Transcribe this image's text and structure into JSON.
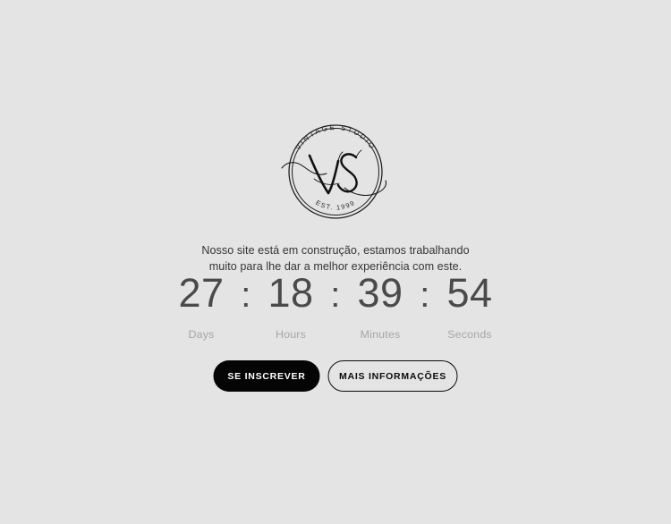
{
  "theme": {
    "background": "#e4e4e4",
    "text_dark": "#343434",
    "countdown_color": "#4a4a4a",
    "label_color": "#a6a6a6",
    "button_primary_bg": "#050505",
    "button_primary_text": "#ffffff",
    "button_outline_border": "#0a0a0a",
    "logo_stroke": "#1c1c1c"
  },
  "logo": {
    "name": "vintage-studio-logo",
    "top_arc_text": "VINTAGE STUDIO",
    "bottom_arc_text": "EST. 1999",
    "monogram": "VS"
  },
  "intro": {
    "text": "Nosso site está em construção, estamos trabalhando muito para lhe dar a melhor experiência com este."
  },
  "countdown": {
    "separator": ":",
    "units": [
      {
        "value": "27",
        "label": "Days"
      },
      {
        "value": "18",
        "label": "Hours"
      },
      {
        "value": "39",
        "label": "Minutes"
      },
      {
        "value": "54",
        "label": "Seconds"
      }
    ]
  },
  "buttons": {
    "primary_label": "SE INSCREVER",
    "secondary_label": "MAIS INFORMAÇÕES"
  }
}
